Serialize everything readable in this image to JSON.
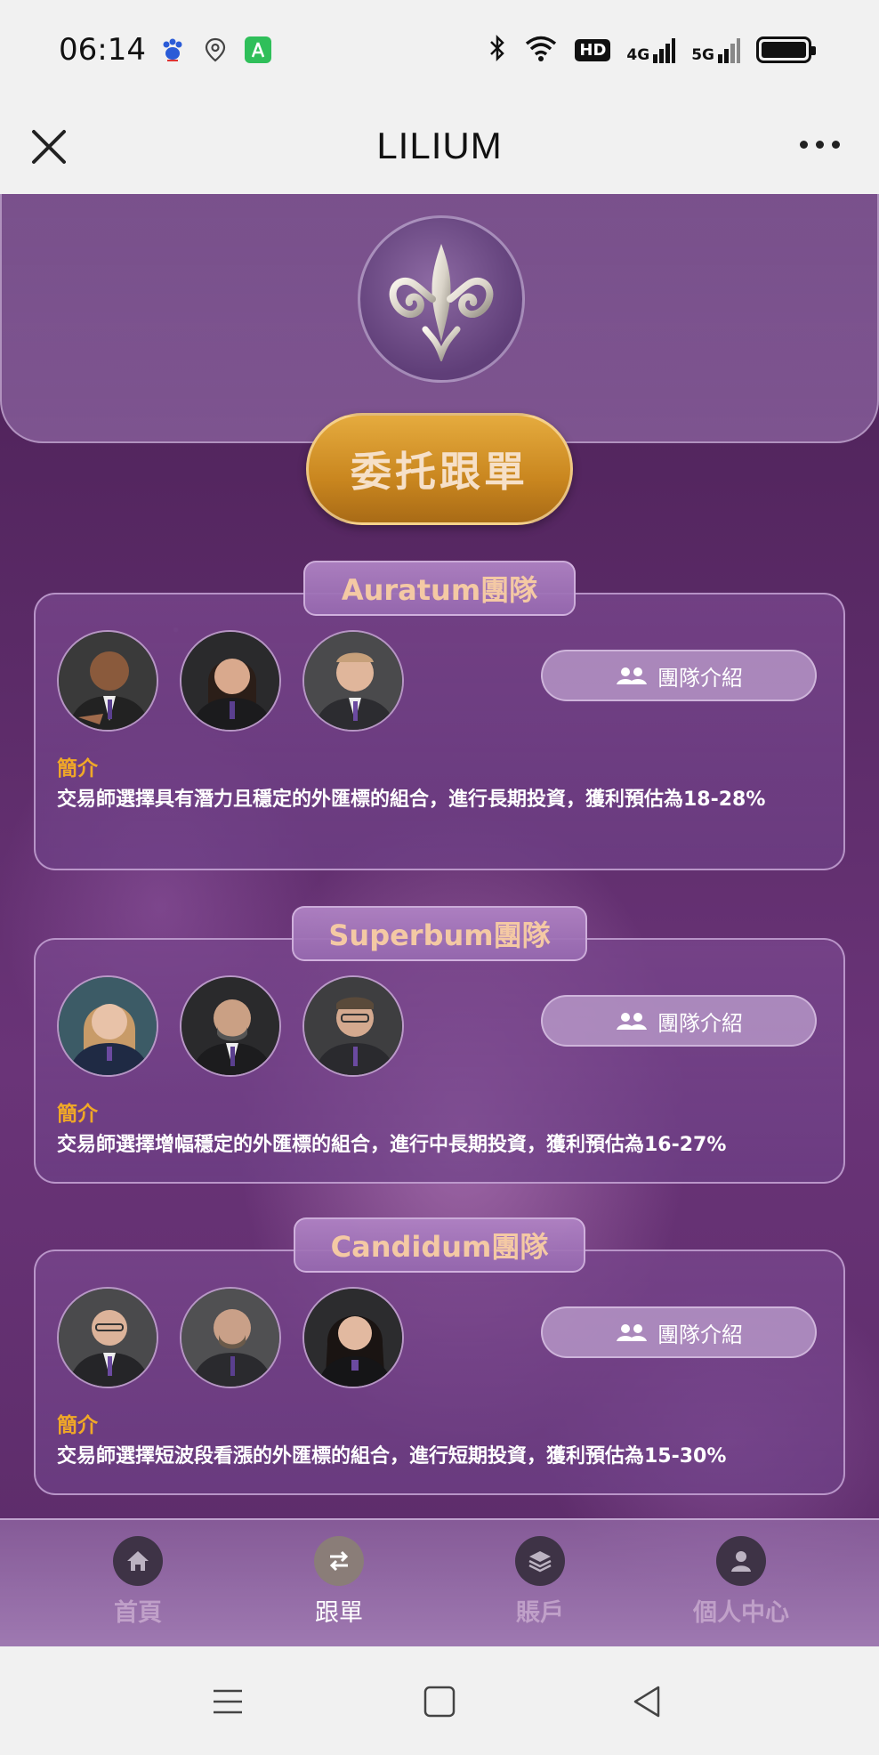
{
  "status_bar": {
    "time": "06:14",
    "hd_badge": "HD",
    "net_4g": "4G",
    "net_5g": "5G",
    "icons": [
      "baidu-paw-icon",
      "location-icon",
      "green-app-icon",
      "bluetooth-icon",
      "wifi-icon",
      "signal-icon",
      "battery-icon"
    ]
  },
  "title_bar": {
    "title": "LILIUM"
  },
  "hero": {
    "cta_label": "委托跟單"
  },
  "teams": [
    {
      "name": "Auratum團隊",
      "intro_button": "團隊介紹",
      "intro_label": "簡介",
      "intro_text": "交易師選擇具有潛力且穩定的外匯標的組合，進行長期投資，獲利預估為18-28%"
    },
    {
      "name": "Superbum團隊",
      "intro_button": "團隊介紹",
      "intro_label": "簡介",
      "intro_text": "交易師選擇增幅穩定的外匯標的組合，進行中長期投資，獲利預估為16-27%"
    },
    {
      "name": "Candidum團隊",
      "intro_button": "團隊介紹",
      "intro_label": "簡介",
      "intro_text": "交易師選擇短波段看漲的外匯標的組合，進行短期投資，獲利預估為15-30%"
    }
  ],
  "tab_bar": {
    "items": [
      {
        "label": "首頁",
        "icon": "home-icon",
        "active": false
      },
      {
        "label": "跟單",
        "icon": "swap-icon",
        "active": true
      },
      {
        "label": "賬戶",
        "icon": "layers-icon",
        "active": false
      },
      {
        "label": "個人中心",
        "icon": "user-icon",
        "active": false
      }
    ]
  },
  "colors": {
    "accent_gold": "#e0a43a",
    "label_orange": "#f0a827",
    "tab_text": "#f4c9a4",
    "background_purple": "#5a2a66"
  }
}
